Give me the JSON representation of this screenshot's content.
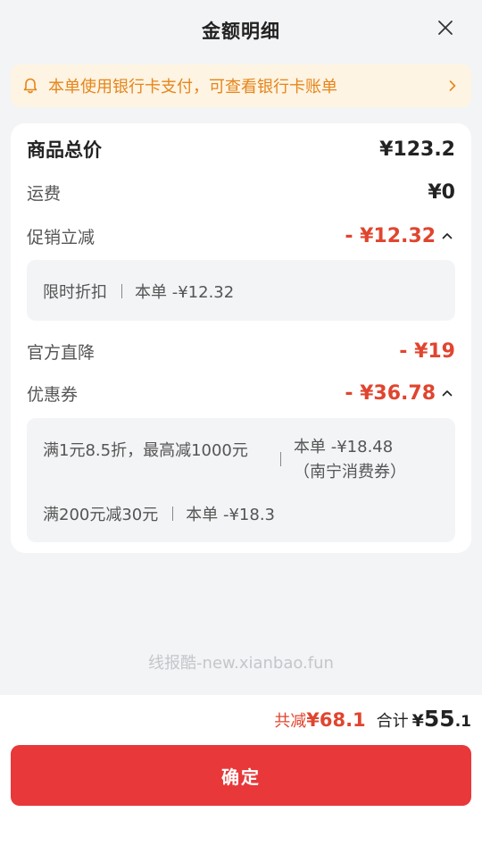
{
  "header": {
    "title": "金额明细",
    "close_icon": "close-icon"
  },
  "notice": {
    "icon": "bell-icon",
    "text": "本单使用银行卡支付，可查看银行卡账单",
    "chevron": "chevron-right-icon",
    "color": "#e6851a",
    "bg": "#fdf4e3"
  },
  "summary": {
    "goods_total_label": "商品总价",
    "goods_total_value": "¥123.2",
    "shipping_label": "运费",
    "shipping_value": "¥0",
    "promo_label": "促销立减",
    "promo_value": "- ¥12.32",
    "promo_details": [
      {
        "name": "限时折扣",
        "amount": "本单 -¥12.32"
      }
    ],
    "official_label": "官方直降",
    "official_value": "- ¥19",
    "coupon_label": "优惠券",
    "coupon_value": "- ¥36.78",
    "coupon_details": [
      {
        "name": "满1元8.5折，最高减1000元",
        "amount": "本单 -¥18.48",
        "note": "（南宁消费券）"
      },
      {
        "name": "满200元减30元",
        "amount": "本单 -¥18.3"
      }
    ]
  },
  "watermark": "线报酷-new.xianbao.fun",
  "footer": {
    "saved_label": "共减",
    "saved_value": "¥68.1",
    "sum_label": "合计",
    "sum_currency": "¥",
    "sum_int": "55",
    "sum_dec": ".1",
    "confirm_label": "确定",
    "accent": "#e8383a"
  }
}
